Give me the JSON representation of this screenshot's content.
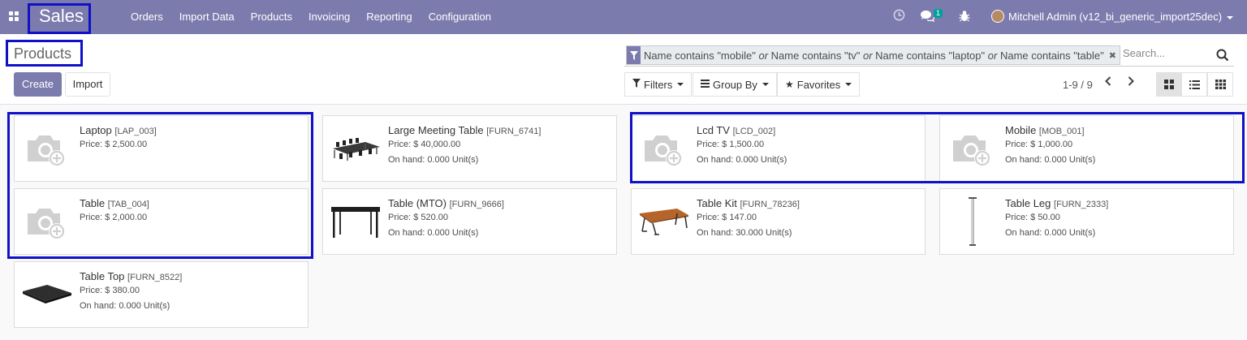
{
  "app": {
    "name": "Sales"
  },
  "menu": [
    "Orders",
    "Import Data",
    "Products",
    "Invoicing",
    "Reporting",
    "Configuration"
  ],
  "systray": {
    "chat_count": "1",
    "user": "Mitchell Admin (v12_bi_generic_import25dec)"
  },
  "breadcrumb": "Products",
  "buttons": {
    "create": "Create",
    "import": "Import"
  },
  "search": {
    "facet_parts": [
      "Name contains \"mobile\"",
      "or",
      "Name contains \"tv\"",
      "or",
      "Name contains \"laptop\"",
      "or",
      "Name contains \"table\""
    ],
    "placeholder": "Search..."
  },
  "filters": {
    "filters": "Filters",
    "group_by": "Group By",
    "favorites": "Favorites"
  },
  "pager": "1-9 / 9",
  "products": [
    {
      "name": "Laptop",
      "code": "[LAP_003]",
      "price": "Price: $ 2,500.00",
      "onhand": "",
      "image": "placeholder"
    },
    {
      "name": "Large Meeting Table",
      "code": "[FURN_6741]",
      "price": "Price: $ 40,000.00",
      "onhand": "On hand: 0.000 Unit(s)",
      "image": "meeting-table"
    },
    {
      "name": "Lcd TV",
      "code": "[LCD_002]",
      "price": "Price: $ 1,500.00",
      "onhand": "On hand: 0.000 Unit(s)",
      "image": "placeholder"
    },
    {
      "name": "Mobile",
      "code": "[MOB_001]",
      "price": "Price: $ 1,000.00",
      "onhand": "On hand: 0.000 Unit(s)",
      "image": "placeholder"
    },
    {
      "name": "Table",
      "code": "[TAB_004]",
      "price": "Price: $ 2,000.00",
      "onhand": "",
      "image": "placeholder"
    },
    {
      "name": "Table (MTO)",
      "code": "[FURN_9666]",
      "price": "Price: $ 520.00",
      "onhand": "On hand: 0.000 Unit(s)",
      "image": "black-table"
    },
    {
      "name": "Table Kit",
      "code": "[FURN_78236]",
      "price": "Price: $ 147.00",
      "onhand": "On hand: 30.000 Unit(s)",
      "image": "wood-table"
    },
    {
      "name": "Table Leg",
      "code": "[FURN_2333]",
      "price": "Price: $ 50.00",
      "onhand": "On hand: 0.000 Unit(s)",
      "image": "table-leg"
    },
    {
      "name": "Table Top",
      "code": "[FURN_8522]",
      "price": "Price: $ 380.00",
      "onhand": "On hand: 0.000 Unit(s)",
      "image": "table-top"
    }
  ],
  "colors": {
    "navbar": "#7c7bad",
    "highlight": "#1010c8",
    "primary": "#7c7bad"
  }
}
